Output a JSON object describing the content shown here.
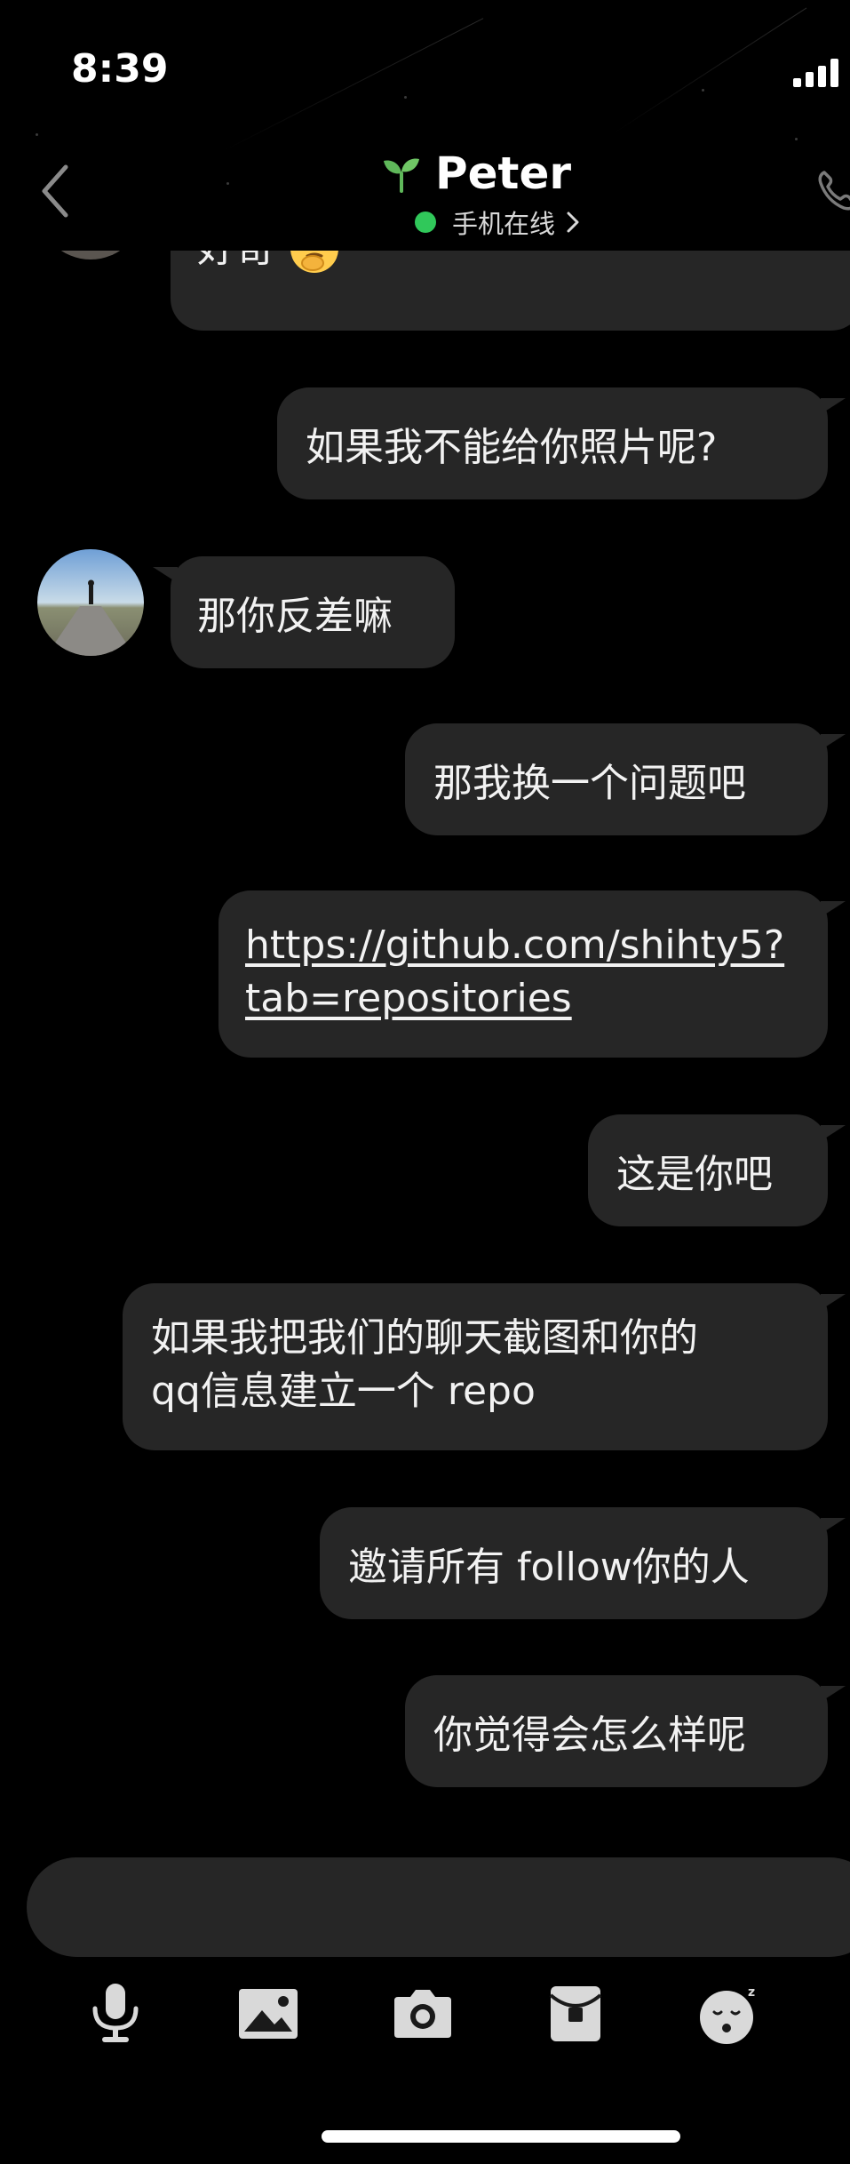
{
  "status_bar": {
    "time": "8:39"
  },
  "header": {
    "contact_name": "Peter",
    "status_text": "手机在线",
    "sprout_icon": "sprout-icon",
    "back_icon": "chevron-left-icon",
    "call_icon": "phone-icon",
    "status_dot_color": "#30c85a"
  },
  "messages": [
    {
      "side": "left",
      "text": "好奇",
      "emoji": "thinking-emoji"
    },
    {
      "side": "right",
      "text": "如果我不能给你照片呢?"
    },
    {
      "side": "left",
      "text": "那你反差嘛"
    },
    {
      "side": "right",
      "text": "那我换一个问题吧"
    },
    {
      "side": "right",
      "text_line1": "https://github.com/shihty5?",
      "text_line2": "tab=repositories"
    },
    {
      "side": "right",
      "text": "这是你吧"
    },
    {
      "side": "right",
      "text_line1": "如果我把我们的聊天截图和你的",
      "text_line2": "qq信息建立一个 repo"
    },
    {
      "side": "right",
      "text": "邀请所有 follow你的人"
    },
    {
      "side": "right",
      "text": "你觉得会怎么样呢"
    }
  ],
  "toolbar": {
    "items": [
      "microphone-icon",
      "image-icon",
      "camera-icon",
      "red-packet-icon",
      "emoji-icon"
    ]
  }
}
